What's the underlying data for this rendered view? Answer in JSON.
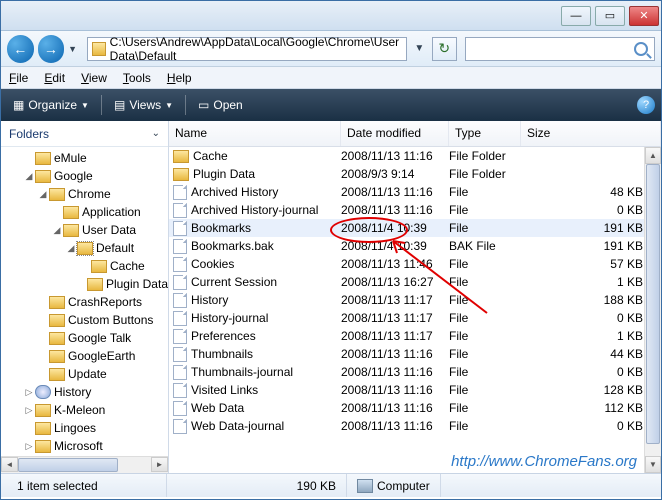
{
  "titlebar": {
    "min": "—",
    "max": "▭",
    "close": "✕"
  },
  "nav": {
    "path": "C:\\Users\\Andrew\\AppData\\Local\\Google\\Chrome\\User Data\\Default"
  },
  "menu": {
    "file": "File",
    "edit": "Edit",
    "view": "View",
    "tools": "Tools",
    "help": "Help"
  },
  "toolbar": {
    "organize": "Organize",
    "views": "Views",
    "open": "Open"
  },
  "folders_hdr": "Folders",
  "tree": [
    {
      "pad": 22,
      "exp": "",
      "icon": "fold",
      "label": "eMule"
    },
    {
      "pad": 22,
      "exp": "◢",
      "icon": "fold",
      "label": "Google"
    },
    {
      "pad": 36,
      "exp": "◢",
      "icon": "fold",
      "label": "Chrome"
    },
    {
      "pad": 50,
      "exp": "",
      "icon": "fold",
      "label": "Application"
    },
    {
      "pad": 50,
      "exp": "◢",
      "icon": "fold",
      "label": "User Data"
    },
    {
      "pad": 64,
      "exp": "◢",
      "icon": "fold",
      "label": "Default",
      "sel": true
    },
    {
      "pad": 78,
      "exp": "",
      "icon": "fold",
      "label": "Cache"
    },
    {
      "pad": 78,
      "exp": "",
      "icon": "fold",
      "label": "Plugin Data"
    },
    {
      "pad": 36,
      "exp": "",
      "icon": "fold",
      "label": "CrashReports"
    },
    {
      "pad": 36,
      "exp": "",
      "icon": "fold",
      "label": "Custom Buttons"
    },
    {
      "pad": 36,
      "exp": "",
      "icon": "fold",
      "label": "Google Talk"
    },
    {
      "pad": 36,
      "exp": "",
      "icon": "fold",
      "label": "GoogleEarth"
    },
    {
      "pad": 36,
      "exp": "",
      "icon": "fold",
      "label": "Update"
    },
    {
      "pad": 22,
      "exp": "▷",
      "icon": "hist",
      "label": "History"
    },
    {
      "pad": 22,
      "exp": "▷",
      "icon": "fold",
      "label": "K-Meleon"
    },
    {
      "pad": 22,
      "exp": "",
      "icon": "fold",
      "label": "Lingoes"
    },
    {
      "pad": 22,
      "exp": "▷",
      "icon": "fold",
      "label": "Microsoft"
    }
  ],
  "cols": {
    "name": "Name",
    "date": "Date modified",
    "type": "Type",
    "size": "Size"
  },
  "files": [
    {
      "icon": "fold",
      "name": "Cache",
      "date": "2008/11/13 11:16",
      "type": "File Folder",
      "size": ""
    },
    {
      "icon": "fold",
      "name": "Plugin Data",
      "date": "2008/9/3 9:14",
      "type": "File Folder",
      "size": ""
    },
    {
      "icon": "file",
      "name": "Archived History",
      "date": "2008/11/13 11:16",
      "type": "File",
      "size": "48 KB"
    },
    {
      "icon": "file",
      "name": "Archived History-journal",
      "date": "2008/11/13 11:16",
      "type": "File",
      "size": "0 KB"
    },
    {
      "icon": "file",
      "name": "Bookmarks",
      "date": "2008/11/4 10:39",
      "type": "File",
      "size": "191 KB",
      "sel": true
    },
    {
      "icon": "file",
      "name": "Bookmarks.bak",
      "date": "2008/11/4 10:39",
      "type": "BAK File",
      "size": "191 KB"
    },
    {
      "icon": "file",
      "name": "Cookies",
      "date": "2008/11/13 11:46",
      "type": "File",
      "size": "57 KB"
    },
    {
      "icon": "file",
      "name": "Current Session",
      "date": "2008/11/13 16:27",
      "type": "File",
      "size": "1 KB"
    },
    {
      "icon": "file",
      "name": "History",
      "date": "2008/11/13 11:17",
      "type": "File",
      "size": "188 KB"
    },
    {
      "icon": "file",
      "name": "History-journal",
      "date": "2008/11/13 11:17",
      "type": "File",
      "size": "0 KB"
    },
    {
      "icon": "file",
      "name": "Preferences",
      "date": "2008/11/13 11:17",
      "type": "File",
      "size": "1 KB"
    },
    {
      "icon": "file",
      "name": "Thumbnails",
      "date": "2008/11/13 11:16",
      "type": "File",
      "size": "44 KB"
    },
    {
      "icon": "file",
      "name": "Thumbnails-journal",
      "date": "2008/11/13 11:16",
      "type": "File",
      "size": "0 KB"
    },
    {
      "icon": "file",
      "name": "Visited Links",
      "date": "2008/11/13 11:16",
      "type": "File",
      "size": "128 KB"
    },
    {
      "icon": "file",
      "name": "Web Data",
      "date": "2008/11/13 11:16",
      "type": "File",
      "size": "112 KB"
    },
    {
      "icon": "file",
      "name": "Web Data-journal",
      "date": "2008/11/13 11:16",
      "type": "File",
      "size": "0 KB"
    }
  ],
  "watermark": "http://www.ChromeFans.org",
  "status": {
    "sel": "1 item selected",
    "size": "190 KB",
    "comp": "Computer"
  }
}
